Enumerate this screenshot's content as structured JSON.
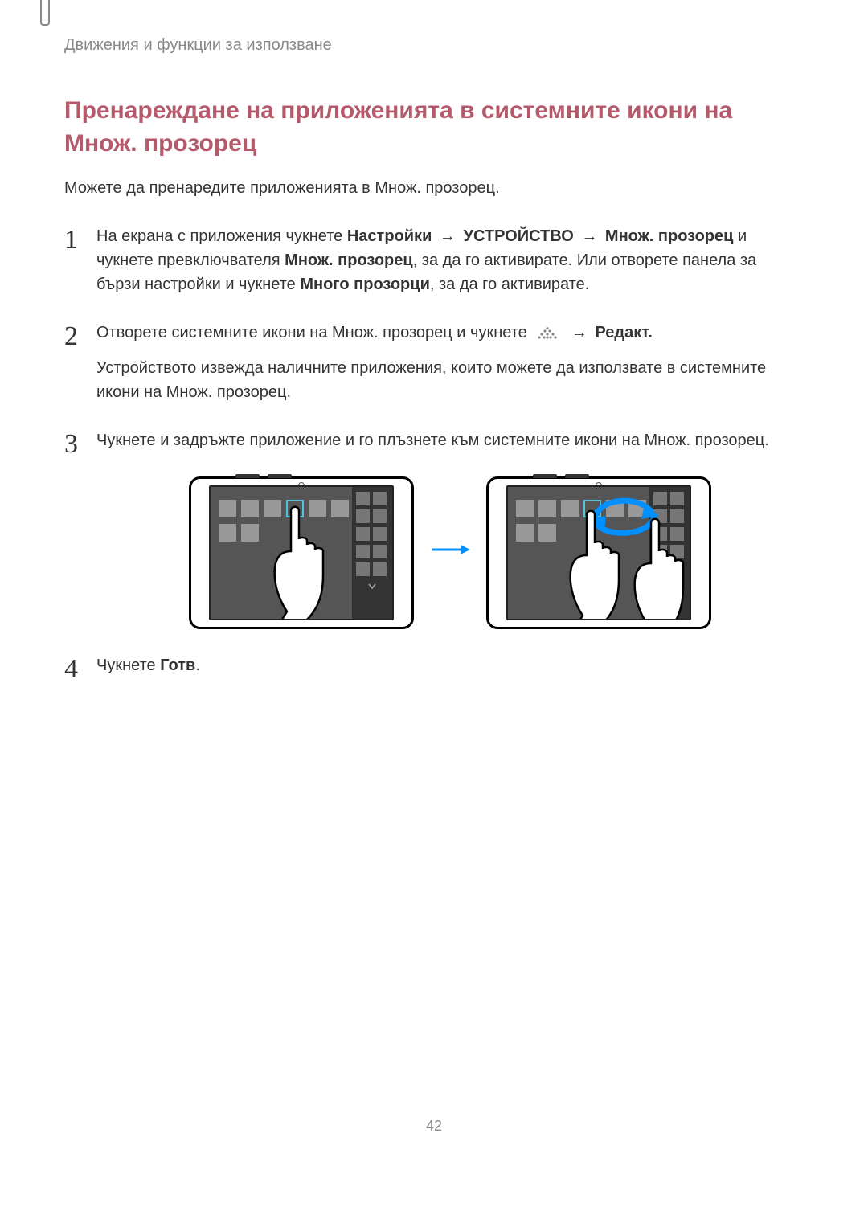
{
  "breadcrumb": "Движения и функции за използване",
  "section_title": "Пренареждане на приложенията в системните икони на Множ. прозорец",
  "intro": "Можете да пренаредите приложенията в Множ. прозорец.",
  "steps": {
    "s1": {
      "part1": "На екрана с приложения чукнете ",
      "bold1": "Настройки",
      "arrow1": " → ",
      "bold2": "УСТРОЙСТВО",
      "arrow2": " → ",
      "bold3": "Множ. прозорец",
      "part2": " и чукнете превключвателя ",
      "bold4": "Множ. прозорец",
      "part3": ", за да го активирате. Или отворете панела за бързи настройки и чукнете ",
      "bold5": "Много прозорци",
      "part4": ", за да го активирате."
    },
    "s2": {
      "part1": "Отворете системните икони на Множ. прозорец и чукнете ",
      "arrow": " → ",
      "bold": "Редакт.",
      "para2": "Устройството извежда наличните приложения, които можете да използвате в системните икони на Множ. прозорец."
    },
    "s3": {
      "text": "Чукнете и задръжте приложение и го плъзнете към системните икони на Множ. прозорец."
    },
    "s4": {
      "part1": "Чукнете ",
      "bold": "Готв",
      "part2": "."
    }
  },
  "page_number": "42"
}
